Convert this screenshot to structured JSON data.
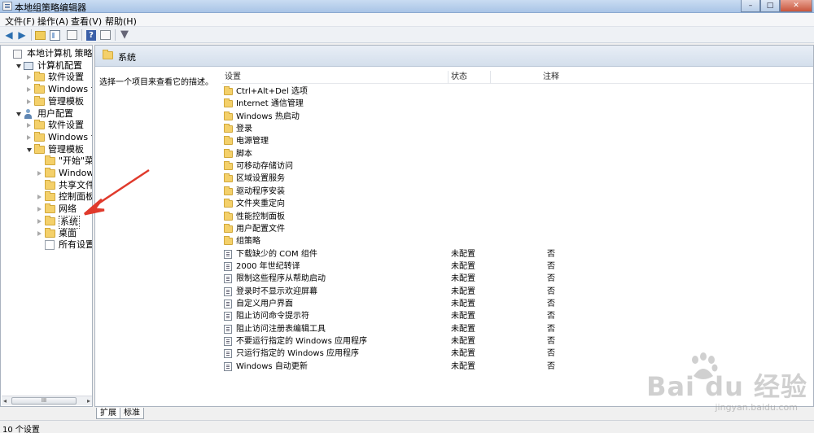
{
  "window": {
    "title": "本地组策略编辑器",
    "min": "–",
    "max": "□",
    "close": "✕"
  },
  "menu": [
    "文件(F)",
    "操作(A)",
    "查看(V)",
    "帮助(H)"
  ],
  "toolbar": {
    "back": "◀",
    "forward": "▶",
    "help": "?",
    "filter": "▼"
  },
  "tree": [
    {
      "label": "本地计算机 策略",
      "icon": "root-icon",
      "expander": "none"
    },
    {
      "label": "计算机配置",
      "icon": "computer-icon",
      "expander": "open"
    },
    {
      "label": "软件设置",
      "icon": "folder-icon",
      "expander": "closed"
    },
    {
      "label": "Windows 设置",
      "icon": "folder-icon",
      "expander": "closed"
    },
    {
      "label": "管理模板",
      "icon": "folder-icon",
      "expander": "closed"
    },
    {
      "label": "用户配置",
      "icon": "user-icon",
      "expander": "open"
    },
    {
      "label": "软件设置",
      "icon": "folder-icon",
      "expander": "closed"
    },
    {
      "label": "Windows 设置",
      "icon": "folder-icon",
      "expander": "closed"
    },
    {
      "label": "管理模板",
      "icon": "folder-icon",
      "expander": "open"
    },
    {
      "label": "\"开始\"菜单",
      "icon": "folder-icon",
      "expander": "none"
    },
    {
      "label": "Windows 组件",
      "icon": "folder-icon",
      "expander": "closed"
    },
    {
      "label": "共享文件夹",
      "icon": "folder-icon",
      "expander": "none"
    },
    {
      "label": "控制面板",
      "icon": "folder-icon",
      "expander": "closed"
    },
    {
      "label": "网络",
      "icon": "folder-icon",
      "expander": "closed"
    },
    {
      "label": "系统",
      "icon": "folder-icon",
      "expander": "closed",
      "selected": true
    },
    {
      "label": "桌面",
      "icon": "folder-icon",
      "expander": "closed"
    },
    {
      "label": "所有设置",
      "icon": "all-settings-icon",
      "expander": "none"
    }
  ],
  "scrollbar": {
    "grip": "III",
    "left": "◂",
    "right": "▸"
  },
  "pane": {
    "title": "系统",
    "description": "选择一个项目来查看它的描述。",
    "columns": [
      "设置",
      "状态",
      "注释"
    ]
  },
  "folders": [
    "Ctrl+Alt+Del 选项",
    "Internet 通信管理",
    "Windows 热启动",
    "登录",
    "电源管理",
    "脚本",
    "可移动存储访问",
    "区域设置服务",
    "驱动程序安装",
    "文件夹重定向",
    "性能控制面板",
    "用户配置文件",
    "组策略"
  ],
  "policies": [
    {
      "name": "下载缺少的 COM 组件",
      "state": "未配置",
      "note": "否"
    },
    {
      "name": "2000 年世纪转译",
      "state": "未配置",
      "note": "否"
    },
    {
      "name": "限制这些程序从帮助启动",
      "state": "未配置",
      "note": "否"
    },
    {
      "name": "登录时不显示欢迎屏幕",
      "state": "未配置",
      "note": "否"
    },
    {
      "name": "自定义用户界面",
      "state": "未配置",
      "note": "否"
    },
    {
      "name": "阻止访问命令提示符",
      "state": "未配置",
      "note": "否"
    },
    {
      "name": "阻止访问注册表编辑工具",
      "state": "未配置",
      "note": "否"
    },
    {
      "name": "不要运行指定的 Windows 应用程序",
      "state": "未配置",
      "note": "否"
    },
    {
      "name": "只运行指定的 Windows 应用程序",
      "state": "未配置",
      "note": "否"
    },
    {
      "name": "Windows 自动更新",
      "state": "未配置",
      "note": "否"
    }
  ],
  "tabs": [
    "扩展",
    "标准"
  ],
  "status": "10 个设置",
  "watermark": {
    "main": "Bai du 经验",
    "sub": "jingyan.baidu.com"
  },
  "colors": {
    "annotation_arrow": "#e03a2c",
    "folder": "#f4d06a"
  }
}
